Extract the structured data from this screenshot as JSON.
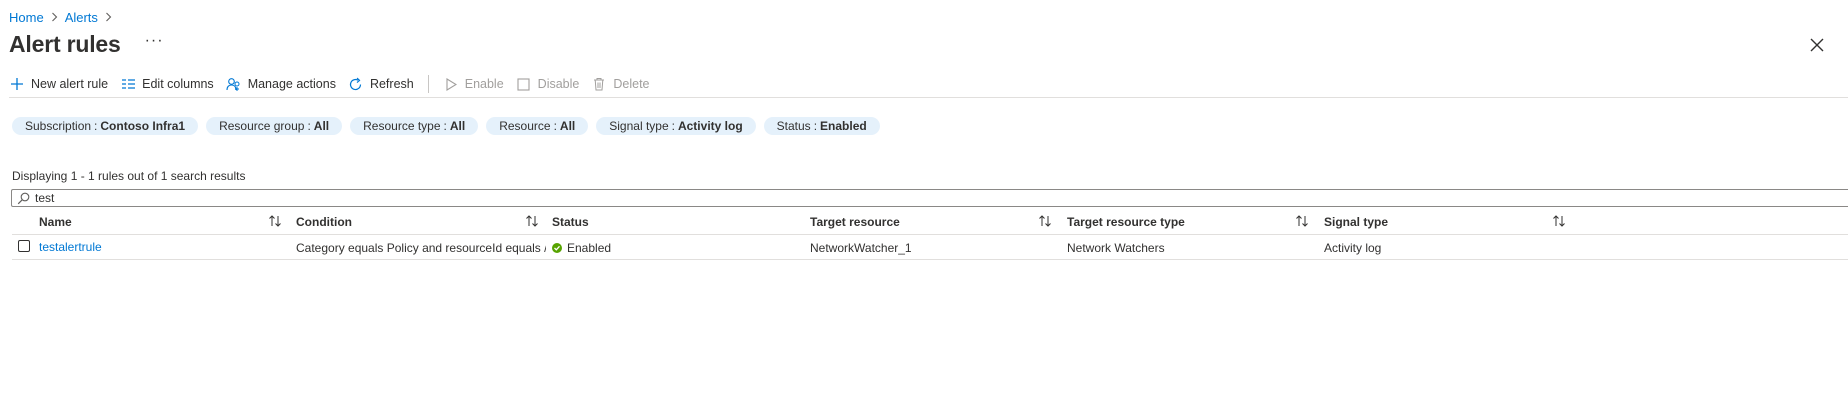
{
  "breadcrumb": {
    "items": [
      {
        "label": "Home"
      },
      {
        "label": "Alerts"
      }
    ]
  },
  "header": {
    "title": "Alert rules",
    "more_label": "···"
  },
  "toolbar": {
    "new_alert_rule": "New alert rule",
    "edit_columns": "Edit columns",
    "manage_actions": "Manage actions",
    "refresh": "Refresh",
    "enable": "Enable",
    "disable": "Disable",
    "delete": "Delete"
  },
  "filters": [
    {
      "key": "Subscription",
      "value": "Contoso Infra1"
    },
    {
      "key": "Resource group",
      "value": "All"
    },
    {
      "key": "Resource type",
      "value": "All"
    },
    {
      "key": "Resource",
      "value": "All"
    },
    {
      "key": "Signal type",
      "value": "Activity log"
    },
    {
      "key": "Status",
      "value": "Enabled"
    }
  ],
  "results": {
    "summary": "Displaying 1 - 1 rules out of 1 search results"
  },
  "search": {
    "value": "test",
    "placeholder": ""
  },
  "table": {
    "columns": [
      {
        "label": "Name",
        "sortable": true
      },
      {
        "label": "Condition",
        "sortable": true
      },
      {
        "label": "Status",
        "sortable": false
      },
      {
        "label": "Target resource",
        "sortable": true
      },
      {
        "label": "Target resource type",
        "sortable": true
      },
      {
        "label": "Signal type",
        "sortable": true
      }
    ],
    "rows": [
      {
        "name": "testalertrule",
        "condition": "Category equals Policy and resourceId equals /subscrip...",
        "status": "Enabled",
        "target_resource": "NetworkWatcher_1",
        "target_resource_type": "Network Watchers",
        "signal_type": "Activity log"
      }
    ]
  },
  "colors": {
    "accent": "#0078d4",
    "pill_bg": "#e5f1fb",
    "status_enabled": "#57a300"
  },
  "icons": {
    "new": "plus-icon",
    "edit_columns": "columns-icon",
    "manage_actions": "people-icon",
    "refresh": "refresh-icon",
    "enable": "play-icon",
    "disable": "square-icon",
    "delete": "trash-icon",
    "search": "search-icon",
    "close": "close-icon",
    "sort": "sort-icon"
  }
}
